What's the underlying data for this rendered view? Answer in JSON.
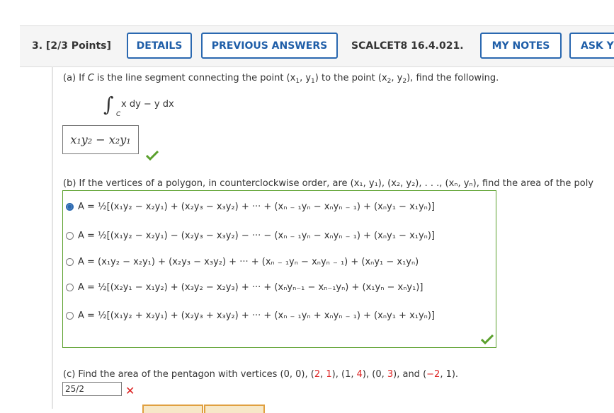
{
  "question": {
    "number_label": "3. [2/3 Points]",
    "buttons": {
      "details": "DETAILS",
      "previous_answers": "PREVIOUS ANSWERS",
      "my_notes": "MY NOTES",
      "ask": "ASK YO"
    },
    "source": "SCALCET8 16.4.021."
  },
  "part_a": {
    "prompt_start": "(a) If ",
    "prompt_var": "C",
    "prompt_rest": " is the line segment connecting the point (x",
    "prompt_tail": ") to the point (x",
    "prompt_end": "), find the following.",
    "integral_body": "x dy − y dx",
    "integral_sub": "C",
    "answer": "x₁y₂ − x₂y₁"
  },
  "part_b": {
    "prompt": "(b) If the vertices of a polygon, in counterclockwise order, are (x₁, y₁), (x₂, y₂), . . ., (xₙ, yₙ), find the area of the poly",
    "options": [
      {
        "selected": true,
        "label": "A = ½[(x₁y₂ − x₂y₁) + (x₂y₃ − x₃y₂) + ··· + (xₙ ₋ ₁yₙ − xₙyₙ ₋ ₁) + (xₙy₁ − x₁yₙ)]"
      },
      {
        "selected": false,
        "label": "A = ½[(x₁y₂ − x₂y₁) − (x₂y₃ − x₃y₂) − ··· − (xₙ ₋ ₁yₙ − xₙyₙ ₋ ₁) + (xₙy₁ − x₁yₙ)]"
      },
      {
        "selected": false,
        "label": "A = (x₁y₂ − x₂y₁) + (x₂y₃ − x₃y₂) + ··· + (xₙ ₋ ₁yₙ − xₙyₙ ₋ ₁) + (xₙy₁ − x₁yₙ)"
      },
      {
        "selected": false,
        "label": "A = ½[(x₂y₁ − x₁y₂) + (x₃y₂ − x₂y₃) + ··· + (xₙyₙ₋₁ − xₙ₋₁yₙ) + (x₁yₙ − xₙy₁)]"
      },
      {
        "selected": false,
        "label": "A = ½[(x₁y₂ + x₂y₁) + (x₂y₃ + x₃y₂) + ··· + (xₙ ₋ ₁yₙ + xₙyₙ ₋ ₁) + (xₙy₁ + x₁yₙ)]"
      }
    ]
  },
  "part_c": {
    "prompt_start": "(c) Find the area of the pentagon with vertices (0, 0), (",
    "vertices": [
      "2",
      "1",
      "4",
      "3",
      "−2"
    ],
    "answer": "25/2"
  },
  "status_colors": {
    "correct": "#5aa02c",
    "incorrect": "#d22222",
    "accent": "#2a68b0"
  }
}
